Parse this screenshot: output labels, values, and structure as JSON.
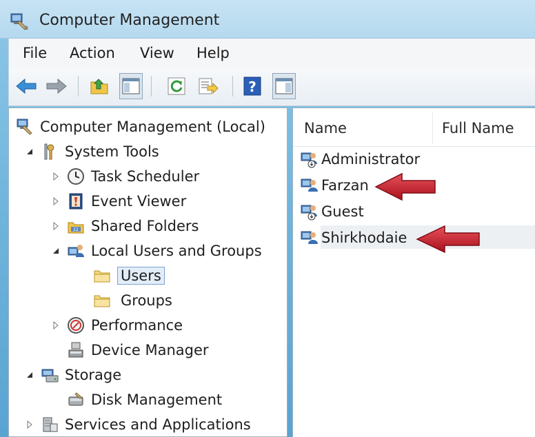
{
  "window": {
    "title": "Computer Management"
  },
  "menu": [
    "File",
    "Action",
    "View",
    "Help"
  ],
  "toolbar": {
    "buttons": [
      "back-icon",
      "forward-icon",
      "up-folder-icon",
      "show-hide-tree-icon",
      "refresh-icon",
      "export-list-icon",
      "help-icon",
      "show-hide-action-pane-icon"
    ]
  },
  "tree": {
    "root": "Computer Management (Local)",
    "system_tools": "System Tools",
    "task_scheduler": "Task Scheduler",
    "event_viewer": "Event Viewer",
    "shared_folders": "Shared Folders",
    "local_users_groups": "Local Users and Groups",
    "users": "Users",
    "groups": "Groups",
    "performance": "Performance",
    "device_manager": "Device Manager",
    "storage": "Storage",
    "disk_management": "Disk Management",
    "services_apps": "Services and Applications"
  },
  "list": {
    "columns": [
      "Name",
      "Full Name"
    ],
    "rows": [
      {
        "name": "Administrator",
        "icon": "disabled-user-icon"
      },
      {
        "name": "Farzan",
        "icon": "user-icon"
      },
      {
        "name": "Guest",
        "icon": "disabled-user-icon"
      },
      {
        "name": "Shirkhodaie",
        "icon": "user-icon"
      }
    ]
  },
  "colors": {
    "annotation_arrow": "#c8202a",
    "selection_border": "#7da2ce",
    "titlebar": "#b5d9ef"
  }
}
